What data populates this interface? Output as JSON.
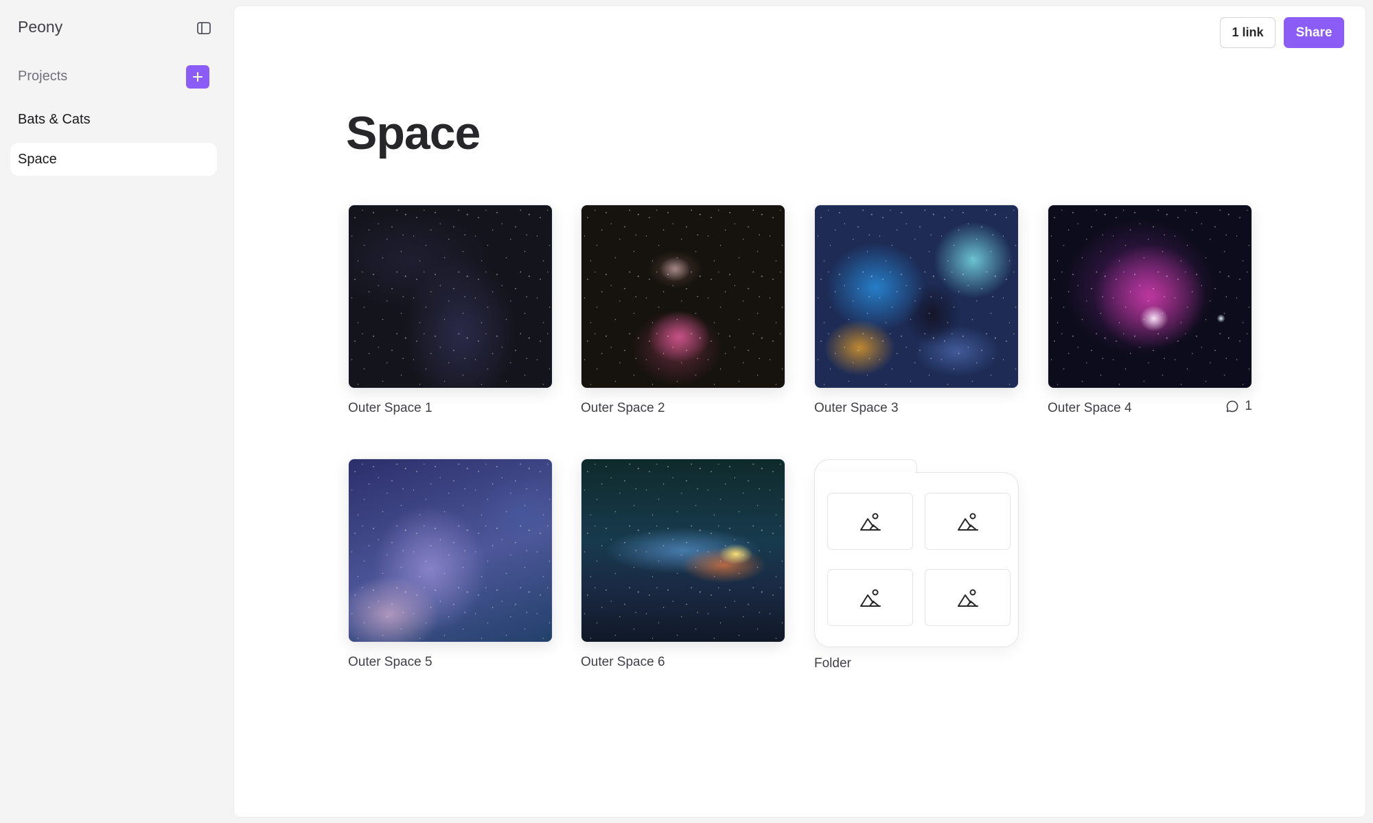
{
  "app": {
    "title": "Peony"
  },
  "sidebar": {
    "projects_label": "Projects",
    "items": [
      {
        "label": "Bats & Cats",
        "active": false
      },
      {
        "label": "Space",
        "active": true
      }
    ]
  },
  "header": {
    "link_count_label": "1 link",
    "share_label": "Share"
  },
  "page": {
    "title": "Space"
  },
  "cards": [
    {
      "label": "Outer Space 1"
    },
    {
      "label": "Outer Space 2"
    },
    {
      "label": "Outer Space 3"
    },
    {
      "label": "Outer Space 4",
      "comment_count": "1"
    },
    {
      "label": "Outer Space 5"
    },
    {
      "label": "Outer Space 6"
    }
  ],
  "folder": {
    "label": "Folder"
  },
  "colors": {
    "accent": "#8b5cf6",
    "active_bg": "#ffffff",
    "sidebar_bg": "#f4f4f5"
  },
  "icons": {
    "sidebar_toggle": "sidebar-toggle-icon",
    "add": "plus-icon",
    "comment": "comment-icon",
    "placeholder": "image-placeholder-icon"
  }
}
